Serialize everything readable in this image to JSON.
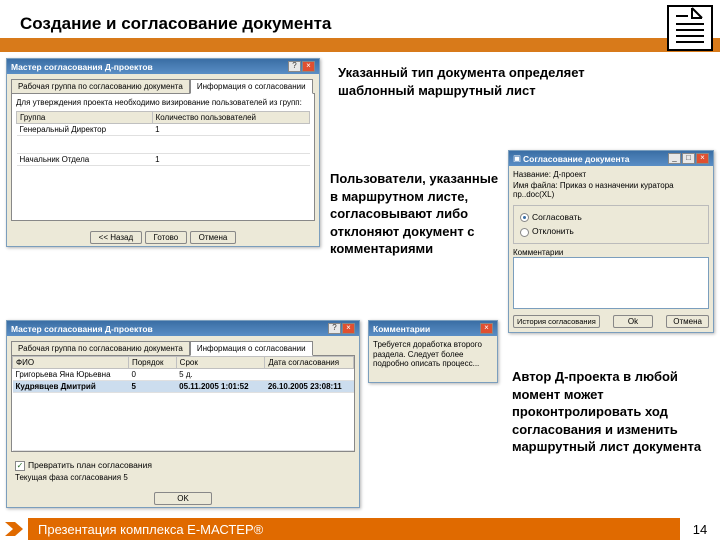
{
  "header": {
    "title": "Создание и согласование документа"
  },
  "callouts": {
    "c1": "Указанный тип документа определяет шаблонный маршрутный лист",
    "c2": "Пользователи, указанные в маршрутном листе, согласовывают либо отклоняют документ с комментариями",
    "c3": "Автор Д-проекта в любой момент может проконтролировать ход согласования и изменить маршрутный лист документа"
  },
  "dlg1": {
    "title": "Мастер согласования Д-проектов",
    "tab1": "Рабочая группа по согласованию документа",
    "tab2": "Информация о согласовании",
    "hint": "Для утверждения проекта необходимо визирование пользователей из групп:",
    "col1": "Группа",
    "col2": "Количество пользователей",
    "row1": {
      "c1": "Генеральный Директор",
      "c2": "1"
    },
    "row2": {
      "c1": "Начальник Отдела",
      "c2": "1"
    },
    "btn_back": "<< Назад",
    "btn_done": "Готово",
    "btn_cancel": "Отмена"
  },
  "dlg2": {
    "title": "Мастер согласования Д-проектов",
    "tab1": "Рабочая группа по согласованию документа",
    "tab2": "Информация о согласовании",
    "col1": "ФИО",
    "col2": "Порядок",
    "col3": "Срок",
    "col4": "Дата согласования",
    "row1": {
      "c1": "Григорьева Яна Юрьевна",
      "c2": "0",
      "c3": "5 д.",
      "c4": ""
    },
    "row2": {
      "c1": "Кудрявцев Дмитрий",
      "c2": "5",
      "c3": "05.11.2005 1:01:52",
      "c4": "26.10.2005 23:08:11"
    },
    "checkbox": "Превратить план согласования",
    "status": "Текущая фаза согласования 5",
    "btn_ok": "OK"
  },
  "dlg3": {
    "title": "Согласование документа",
    "f1_label": "Название: Д-проект",
    "f2_label": "Имя файла: Приказ о назначении куратора пр..doc(XL)",
    "opt1": "Согласовать",
    "opt2": "Отклонить",
    "comment_label": "Комментарии",
    "btn_history": "История согласования",
    "btn_ok": "Ok",
    "btn_cancel": "Отмена"
  },
  "dlg4": {
    "title": "Комментарии",
    "body": "Требуется доработка второго раздела. Следует более подробно описать процесс..."
  },
  "footer": {
    "text": "Презентация комплекса E-МАСТЕР®",
    "page": "14"
  }
}
